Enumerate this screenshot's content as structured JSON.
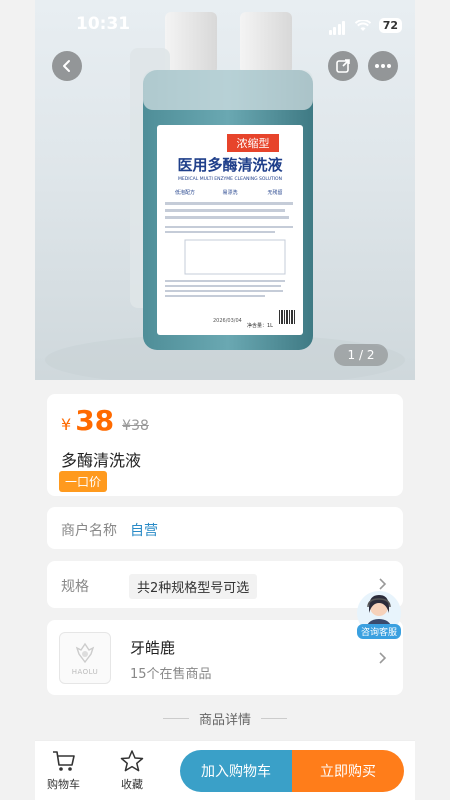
{
  "status_bar": {
    "time": "10:31",
    "battery": "72"
  },
  "gallery": {
    "indicator": "1 / 2",
    "product_label": {
      "tag": "浓缩型",
      "title_cn": "医用多酶清洗液",
      "title_en": "MEDICAL MULTI ENZYME CLEANING SOLUTION",
      "checks": [
        "低泡配方",
        "易漂洗",
        "无残留"
      ],
      "net": "净含量：1L",
      "date": "2026/03/04"
    }
  },
  "product": {
    "currency": "¥",
    "price": "38",
    "original_price": "¥38",
    "name": "多酶清洗液",
    "tag": "一口价"
  },
  "merchant": {
    "label": "商户名称",
    "value": "自营"
  },
  "spec": {
    "label": "规格",
    "value": "共2种规格型号可选"
  },
  "store": {
    "name": "牙皓鹿",
    "count": "15个在售商品",
    "logo_text": "HAOLU"
  },
  "details": {
    "title": "商品详情"
  },
  "service": {
    "label": "咨询客服"
  },
  "bottom_bar": {
    "cart": "购物车",
    "favorite": "收藏",
    "add_to_cart": "加入购物车",
    "buy_now": "立即购买"
  },
  "colors": {
    "accent_orange": "#ff7d1a",
    "accent_blue": "#3aa0c8",
    "link_blue": "#2a8bc7"
  }
}
